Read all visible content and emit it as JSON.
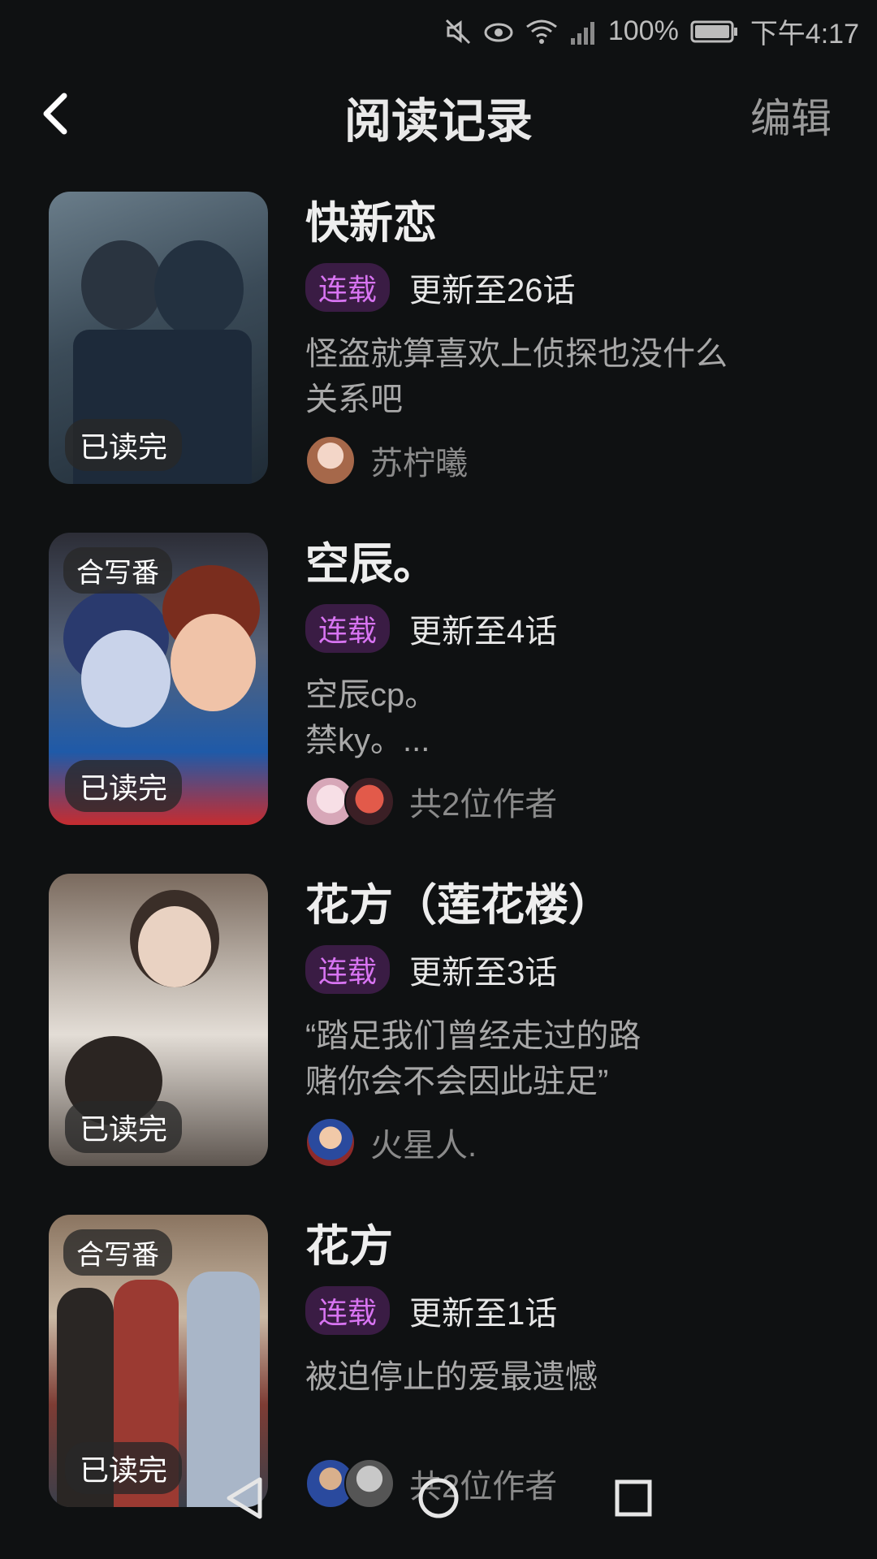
{
  "status_bar": {
    "battery": "100%",
    "time": "下午4:17"
  },
  "header": {
    "title": "阅读记录",
    "edit": "编辑"
  },
  "items": [
    {
      "title": "快新恋",
      "badge_coop": "",
      "badge_read": "已读完",
      "status": "连载",
      "update": "更新至26话",
      "desc": "怪盗就算喜欢上侦探也没什么\n关系吧",
      "author": "苏柠曦"
    },
    {
      "title": "空辰。",
      "badge_coop": "合写番",
      "badge_read": "已读完",
      "status": "连载",
      "update": "更新至4话",
      "desc": "空辰cp。\n禁ky。...",
      "author": "共2位作者"
    },
    {
      "title": "花方（莲花楼）",
      "badge_coop": "",
      "badge_read": "已读完",
      "status": "连载",
      "update": "更新至3话",
      "desc": "“踏足我们曾经走过的路\n赌你会不会因此驻足”",
      "author": "火星人."
    },
    {
      "title": "花方",
      "badge_coop": "合写番",
      "badge_read": "已读完",
      "status": "连载",
      "update": "更新至1话",
      "desc": "被迫停止的爱最遗憾",
      "author": "共2位作者"
    }
  ],
  "icons": {
    "mute": "mute-icon",
    "eye": "eye-comfort-icon",
    "wifi": "wifi-icon",
    "signal": "signal-icon",
    "battery": "battery-icon",
    "back": "back-arrow-icon",
    "nav_back": "nav-back-icon",
    "nav_home": "nav-home-icon",
    "nav_recent": "nav-recent-icon"
  },
  "colors": {
    "background": "#0f1112",
    "tag_bg": "#3a1c44",
    "tag_text": "#d874f2"
  }
}
